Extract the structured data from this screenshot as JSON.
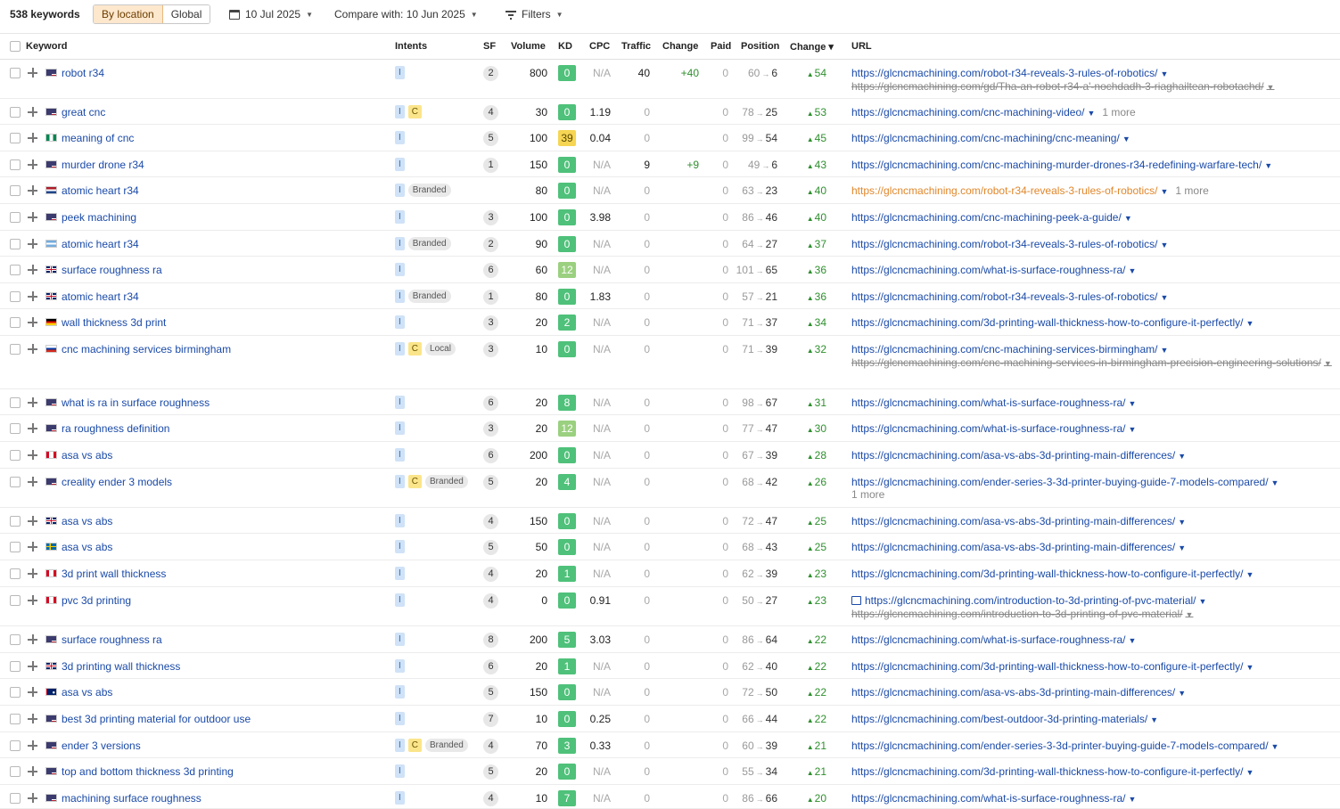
{
  "toolbar": {
    "keywords_count": "538 keywords",
    "by_location": "By location",
    "global": "Global",
    "date": "10 Jul 2025",
    "compare": "Compare with: 10 Jun 2025",
    "filters": "Filters"
  },
  "columns": {
    "keyword": "Keyword",
    "intents": "Intents",
    "sf": "SF",
    "volume": "Volume",
    "kd": "KD",
    "cpc": "CPC",
    "traffic": "Traffic",
    "change": "Change",
    "paid": "Paid",
    "position": "Position",
    "change_pos": "Change ▾",
    "url": "URL"
  },
  "rows": [
    {
      "keyword": "robot r34",
      "flag": "us",
      "intents": [
        "I"
      ],
      "sf": "2",
      "volume": "800",
      "kd": "0",
      "cpc": "N/A",
      "traffic": "40",
      "change": "+40",
      "paid": "0",
      "pos_from": "60",
      "pos_to": "6",
      "delta": "54",
      "url": "https://glcncmachining.com/robot-r34-reveals-3-rules-of-robotics/",
      "url2": "https://glcncmachining.com/gd/Tha-an-robot-r34-a'-nochdadh-3-riaghailtean-robotachd/"
    },
    {
      "keyword": "great cnc",
      "flag": "us",
      "intents": [
        "I",
        "C"
      ],
      "sf": "4",
      "volume": "30",
      "kd": "0",
      "cpc": "1.19",
      "traffic": "0",
      "change": "",
      "paid": "0",
      "pos_from": "78",
      "pos_to": "25",
      "delta": "53",
      "url": "https://glcncmachining.com/cnc-machining-video/",
      "more": "1 more"
    },
    {
      "keyword": "meaning of cnc",
      "flag": "ng",
      "intents": [
        "I"
      ],
      "sf": "5",
      "volume": "100",
      "kd": "39",
      "cpc": "0.04",
      "traffic": "0",
      "change": "",
      "paid": "0",
      "pos_from": "99",
      "pos_to": "54",
      "delta": "45",
      "url": "https://glcncmachining.com/cnc-machining/cnc-meaning/"
    },
    {
      "keyword": "murder drone r34",
      "flag": "us",
      "intents": [
        "I"
      ],
      "sf": "1",
      "volume": "150",
      "kd": "0",
      "cpc": "N/A",
      "traffic": "9",
      "change": "+9",
      "paid": "0",
      "pos_from": "49",
      "pos_to": "6",
      "delta": "43",
      "url": "https://glcncmachining.com/cnc-machining-murder-drones-r34-redefining-warfare-tech/"
    },
    {
      "keyword": "atomic heart r34",
      "flag": "nl",
      "intents": [
        "I",
        "Branded"
      ],
      "sf": "",
      "volume": "80",
      "kd": "0",
      "cpc": "N/A",
      "traffic": "0",
      "change": "",
      "paid": "0",
      "pos_from": "63",
      "pos_to": "23",
      "delta": "40",
      "url": "https://glcncmachining.com/robot-r34-reveals-3-rules-of-robotics/",
      "url_orange": true,
      "more": "1 more"
    },
    {
      "keyword": "peek machining",
      "flag": "us",
      "intents": [
        "I"
      ],
      "sf": "3",
      "volume": "100",
      "kd": "0",
      "cpc": "3.98",
      "traffic": "0",
      "change": "",
      "paid": "0",
      "pos_from": "86",
      "pos_to": "46",
      "delta": "40",
      "url": "https://glcncmachining.com/cnc-machining-peek-a-guide/"
    },
    {
      "keyword": "atomic heart r34",
      "flag": "ar",
      "intents": [
        "I",
        "Branded"
      ],
      "sf": "2",
      "volume": "90",
      "kd": "0",
      "cpc": "N/A",
      "traffic": "0",
      "change": "",
      "paid": "0",
      "pos_from": "64",
      "pos_to": "27",
      "delta": "37",
      "url": "https://glcncmachining.com/robot-r34-reveals-3-rules-of-robotics/"
    },
    {
      "keyword": "surface roughness ra",
      "flag": "gb",
      "intents": [
        "I"
      ],
      "sf": "6",
      "volume": "60",
      "kd": "12",
      "cpc": "N/A",
      "traffic": "0",
      "change": "",
      "paid": "0",
      "pos_from": "101",
      "pos_to": "65",
      "delta": "36",
      "url": "https://glcncmachining.com/what-is-surface-roughness-ra/"
    },
    {
      "keyword": "atomic heart r34",
      "flag": "gb",
      "intents": [
        "I",
        "Branded"
      ],
      "sf": "1",
      "volume": "80",
      "kd": "0",
      "cpc": "1.83",
      "traffic": "0",
      "change": "",
      "paid": "0",
      "pos_from": "57",
      "pos_to": "21",
      "delta": "36",
      "url": "https://glcncmachining.com/robot-r34-reveals-3-rules-of-robotics/"
    },
    {
      "keyword": "wall thickness 3d print",
      "flag": "de",
      "intents": [
        "I"
      ],
      "sf": "3",
      "volume": "20",
      "kd": "2",
      "cpc": "N/A",
      "traffic": "0",
      "change": "",
      "paid": "0",
      "pos_from": "71",
      "pos_to": "37",
      "delta": "34",
      "url": "https://glcncmachining.com/3d-printing-wall-thickness-how-to-configure-it-perfectly/"
    },
    {
      "keyword": "cnc machining services birmingham",
      "flag": "ru",
      "intents": [
        "I",
        "C",
        "Local"
      ],
      "sf": "3",
      "volume": "10",
      "kd": "0",
      "cpc": "N/A",
      "traffic": "0",
      "change": "",
      "paid": "0",
      "pos_from": "71",
      "pos_to": "39",
      "delta": "32",
      "url": "https://glcncmachining.com/cnc-machining-services-birmingham/",
      "url2": "https://glcncmachining.com/cnc-machining-services-in-birmingham-precision-engineering-solutions/",
      "url2_wrap": true
    },
    {
      "keyword": "what is ra in surface roughness",
      "flag": "us",
      "intents": [
        "I"
      ],
      "sf": "6",
      "volume": "20",
      "kd": "8",
      "cpc": "N/A",
      "traffic": "0",
      "change": "",
      "paid": "0",
      "pos_from": "98",
      "pos_to": "67",
      "delta": "31",
      "url": "https://glcncmachining.com/what-is-surface-roughness-ra/"
    },
    {
      "keyword": "ra roughness definition",
      "flag": "us",
      "intents": [
        "I"
      ],
      "sf": "3",
      "volume": "20",
      "kd": "12",
      "cpc": "N/A",
      "traffic": "0",
      "change": "",
      "paid": "0",
      "pos_from": "77",
      "pos_to": "47",
      "delta": "30",
      "url": "https://glcncmachining.com/what-is-surface-roughness-ra/"
    },
    {
      "keyword": "asa vs abs",
      "flag": "ca",
      "intents": [
        "I"
      ],
      "sf": "6",
      "volume": "200",
      "kd": "0",
      "cpc": "N/A",
      "traffic": "0",
      "change": "",
      "paid": "0",
      "pos_from": "67",
      "pos_to": "39",
      "delta": "28",
      "url": "https://glcncmachining.com/asa-vs-abs-3d-printing-main-differences/"
    },
    {
      "keyword": "creality ender 3 models",
      "flag": "us",
      "intents": [
        "I",
        "C",
        "Branded"
      ],
      "sf": "5",
      "volume": "20",
      "kd": "4",
      "cpc": "N/A",
      "traffic": "0",
      "change": "",
      "paid": "0",
      "pos_from": "68",
      "pos_to": "42",
      "delta": "26",
      "url": "https://glcncmachining.com/ender-series-3-3d-printer-buying-guide-7-models-compared/",
      "more_below": "1 more"
    },
    {
      "keyword": "asa vs abs",
      "flag": "gb",
      "intents": [
        "I"
      ],
      "sf": "4",
      "volume": "150",
      "kd": "0",
      "cpc": "N/A",
      "traffic": "0",
      "change": "",
      "paid": "0",
      "pos_from": "72",
      "pos_to": "47",
      "delta": "25",
      "url": "https://glcncmachining.com/asa-vs-abs-3d-printing-main-differences/"
    },
    {
      "keyword": "asa vs abs",
      "flag": "se",
      "intents": [
        "I"
      ],
      "sf": "5",
      "volume": "50",
      "kd": "0",
      "cpc": "N/A",
      "traffic": "0",
      "change": "",
      "paid": "0",
      "pos_from": "68",
      "pos_to": "43",
      "delta": "25",
      "url": "https://glcncmachining.com/asa-vs-abs-3d-printing-main-differences/"
    },
    {
      "keyword": "3d print wall thickness",
      "flag": "ca",
      "intents": [
        "I"
      ],
      "sf": "4",
      "volume": "20",
      "kd": "1",
      "cpc": "N/A",
      "traffic": "0",
      "change": "",
      "paid": "0",
      "pos_from": "62",
      "pos_to": "39",
      "delta": "23",
      "url": "https://glcncmachining.com/3d-printing-wall-thickness-how-to-configure-it-perfectly/"
    },
    {
      "keyword": "pvc 3d printing",
      "flag": "ca",
      "intents": [
        "I"
      ],
      "sf": "4",
      "volume": "0",
      "kd": "0",
      "cpc": "0.91",
      "traffic": "0",
      "change": "",
      "paid": "0",
      "pos_from": "50",
      "pos_to": "27",
      "delta": "23",
      "url": "https://glcncmachining.com/introduction-to-3d-printing-of-pvc-material/",
      "url_icon": true,
      "url2": "https://glcncmachining.com/introduction-to-3d-printing-of-pvc-material/"
    },
    {
      "keyword": "surface roughness ra",
      "flag": "us",
      "intents": [
        "I"
      ],
      "sf": "8",
      "volume": "200",
      "kd": "5",
      "cpc": "3.03",
      "traffic": "0",
      "change": "",
      "paid": "0",
      "pos_from": "86",
      "pos_to": "64",
      "delta": "22",
      "url": "https://glcncmachining.com/what-is-surface-roughness-ra/"
    },
    {
      "keyword": "3d printing wall thickness",
      "flag": "gb",
      "intents": [
        "I"
      ],
      "sf": "6",
      "volume": "20",
      "kd": "1",
      "cpc": "N/A",
      "traffic": "0",
      "change": "",
      "paid": "0",
      "pos_from": "62",
      "pos_to": "40",
      "delta": "22",
      "url": "https://glcncmachining.com/3d-printing-wall-thickness-how-to-configure-it-perfectly/"
    },
    {
      "keyword": "asa vs abs",
      "flag": "au",
      "intents": [
        "I"
      ],
      "sf": "5",
      "volume": "150",
      "kd": "0",
      "cpc": "N/A",
      "traffic": "0",
      "change": "",
      "paid": "0",
      "pos_from": "72",
      "pos_to": "50",
      "delta": "22",
      "url": "https://glcncmachining.com/asa-vs-abs-3d-printing-main-differences/"
    },
    {
      "keyword": "best 3d printing material for outdoor use",
      "flag": "us",
      "intents": [
        "I"
      ],
      "sf": "7",
      "volume": "10",
      "kd": "0",
      "cpc": "0.25",
      "traffic": "0",
      "change": "",
      "paid": "0",
      "pos_from": "66",
      "pos_to": "44",
      "delta": "22",
      "url": "https://glcncmachining.com/best-outdoor-3d-printing-materials/"
    },
    {
      "keyword": "ender 3 versions",
      "flag": "us",
      "intents": [
        "I",
        "C",
        "Branded"
      ],
      "sf": "4",
      "volume": "70",
      "kd": "3",
      "cpc": "0.33",
      "traffic": "0",
      "change": "",
      "paid": "0",
      "pos_from": "60",
      "pos_to": "39",
      "delta": "21",
      "url": "https://glcncmachining.com/ender-series-3-3d-printer-buying-guide-7-models-compared/"
    },
    {
      "keyword": "top and bottom thickness 3d printing",
      "flag": "us",
      "intents": [
        "I"
      ],
      "sf": "5",
      "volume": "20",
      "kd": "0",
      "cpc": "N/A",
      "traffic": "0",
      "change": "",
      "paid": "0",
      "pos_from": "55",
      "pos_to": "34",
      "delta": "21",
      "url": "https://glcncmachining.com/3d-printing-wall-thickness-how-to-configure-it-perfectly/"
    },
    {
      "keyword": "machining surface roughness",
      "flag": "us",
      "intents": [
        "I"
      ],
      "sf": "4",
      "volume": "10",
      "kd": "7",
      "cpc": "N/A",
      "traffic": "0",
      "change": "",
      "paid": "0",
      "pos_from": "86",
      "pos_to": "66",
      "delta": "20",
      "url": "https://glcncmachining.com/what-is-surface-roughness-ra/"
    }
  ],
  "colors": {
    "kd_green": "#4fc17a",
    "kd_lightgreen": "#9ad07f",
    "kd_yellow": "#f5d553",
    "link": "#1a4aa8",
    "positive": "#2f8f2f"
  }
}
